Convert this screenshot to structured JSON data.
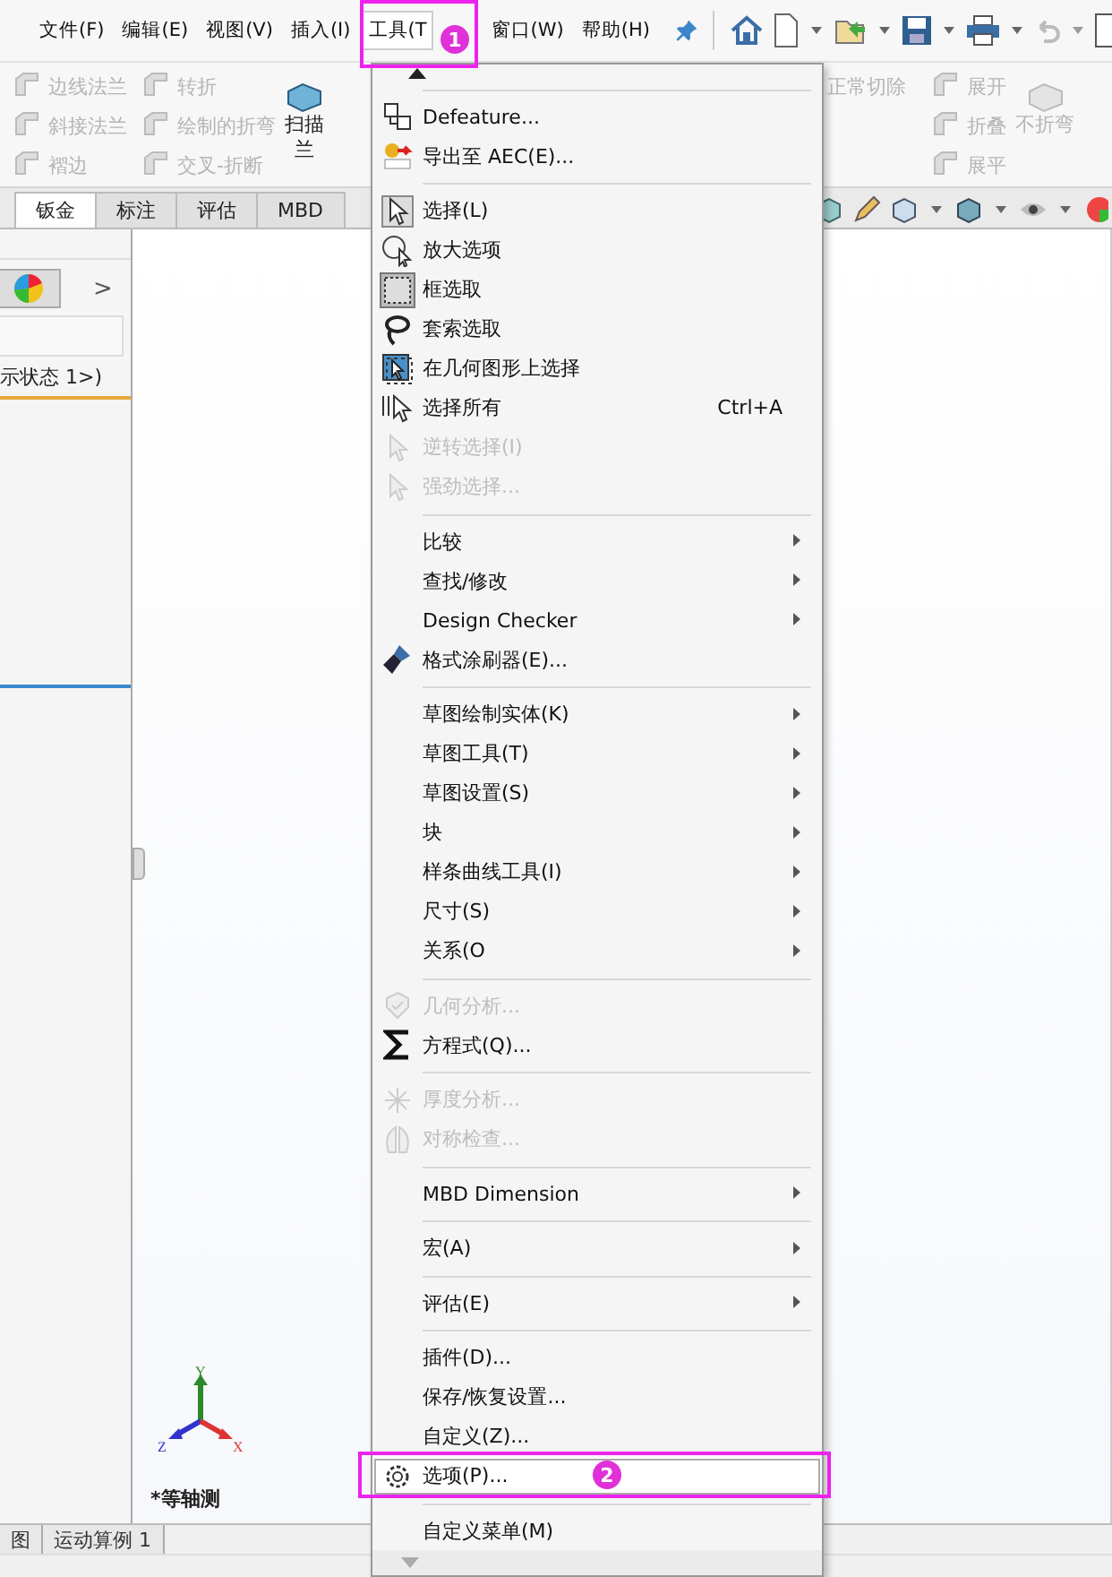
{
  "menubar": {
    "items": [
      {
        "label": "文件(F)",
        "selected": false
      },
      {
        "label": "编辑(E)",
        "selected": false
      },
      {
        "label": "视图(V)",
        "selected": false
      },
      {
        "label": "插入(I)",
        "selected": false
      },
      {
        "label": "工具(T",
        "selected": true
      },
      {
        "label": "窗口(W)",
        "selected": false
      },
      {
        "label": "帮助(H)",
        "selected": false
      }
    ]
  },
  "ribbon": {
    "columns": [
      {
        "kind": "small",
        "items": [
          {
            "label": "边线法兰",
            "disabled": true
          },
          {
            "label": "斜接法兰",
            "disabled": true
          },
          {
            "label": "褶边",
            "disabled": true
          }
        ]
      },
      {
        "kind": "small",
        "items": [
          {
            "label": "转折",
            "disabled": true
          },
          {
            "label": "绘制的折弯",
            "disabled": true
          },
          {
            "label": "交叉-折断",
            "disabled": true
          }
        ]
      },
      {
        "kind": "large",
        "lines": [
          "扫描",
          "兰"
        ],
        "disabled": false
      },
      {
        "kind": "label",
        "items": [
          {
            "label": "正常切除",
            "disabled": true
          }
        ]
      },
      {
        "kind": "small",
        "items": [
          {
            "label": "展开",
            "disabled": true
          },
          {
            "label": "折叠",
            "disabled": true
          },
          {
            "label": "展平",
            "disabled": true
          }
        ]
      },
      {
        "kind": "large",
        "lines": [
          "不折弯"
        ],
        "disabled": true
      }
    ]
  },
  "tabs": [
    {
      "label": "钣金",
      "selected": true
    },
    {
      "label": "标注",
      "selected": false
    },
    {
      "label": "评估",
      "selected": false
    },
    {
      "label": "MBD",
      "selected": false
    }
  ],
  "left_panel": {
    "chevron": ">",
    "config_text": "示状态 1>)"
  },
  "viewport": {
    "view_name": "*等轴测",
    "triad": {
      "x": "X",
      "y": "Y",
      "z": "Z"
    }
  },
  "bottom_tabs": [
    {
      "label": "图",
      "selected": false
    },
    {
      "label": "运动算例 1",
      "selected": false
    }
  ],
  "menu": {
    "items": [
      {
        "kind": "item",
        "label": "Defeature...",
        "disabled": false,
        "submenu": false,
        "selected": false
      },
      {
        "kind": "item",
        "label": "导出至 AEC(E)...",
        "disabled": false,
        "submenu": false,
        "selected": false
      },
      {
        "kind": "separator"
      },
      {
        "kind": "item",
        "label": "选择(L)",
        "disabled": false,
        "submenu": false,
        "selected": false
      },
      {
        "kind": "item",
        "label": "放大选项",
        "disabled": false,
        "submenu": false,
        "selected": false
      },
      {
        "kind": "item",
        "label": "框选取",
        "disabled": false,
        "submenu": false,
        "selected": false
      },
      {
        "kind": "item",
        "label": "套索选取",
        "disabled": false,
        "submenu": false,
        "selected": false
      },
      {
        "kind": "item",
        "label": "在几何图形上选择",
        "disabled": false,
        "submenu": false,
        "selected": false
      },
      {
        "kind": "item",
        "label": "选择所有",
        "shortcut": "Ctrl+A",
        "disabled": false,
        "submenu": false,
        "selected": false
      },
      {
        "kind": "item",
        "label": "逆转选择(I)",
        "disabled": true,
        "submenu": false,
        "selected": false
      },
      {
        "kind": "item",
        "label": "强劲选择...",
        "disabled": true,
        "submenu": false,
        "selected": false
      },
      {
        "kind": "separator"
      },
      {
        "kind": "item",
        "label": "比较",
        "disabled": false,
        "submenu": true,
        "selected": false
      },
      {
        "kind": "item",
        "label": "查找/修改",
        "disabled": false,
        "submenu": true,
        "selected": false
      },
      {
        "kind": "item",
        "label": "Design Checker",
        "disabled": false,
        "submenu": true,
        "selected": false
      },
      {
        "kind": "item",
        "label": "格式涂刷器(E)...",
        "disabled": false,
        "submenu": false,
        "selected": false
      },
      {
        "kind": "separator"
      },
      {
        "kind": "item",
        "label": "草图绘制实体(K)",
        "disabled": false,
        "submenu": true,
        "selected": false
      },
      {
        "kind": "item",
        "label": "草图工具(T)",
        "disabled": false,
        "submenu": true,
        "selected": false
      },
      {
        "kind": "item",
        "label": "草图设置(S)",
        "disabled": false,
        "submenu": true,
        "selected": false
      },
      {
        "kind": "item",
        "label": "块",
        "disabled": false,
        "submenu": true,
        "selected": false
      },
      {
        "kind": "item",
        "label": "样条曲线工具(I)",
        "disabled": false,
        "submenu": true,
        "selected": false
      },
      {
        "kind": "item",
        "label": "尺寸(S)",
        "disabled": false,
        "submenu": true,
        "selected": false
      },
      {
        "kind": "item",
        "label": "关系(O",
        "disabled": false,
        "submenu": true,
        "selected": false
      },
      {
        "kind": "separator"
      },
      {
        "kind": "item",
        "label": "几何分析...",
        "disabled": true,
        "submenu": false,
        "selected": false
      },
      {
        "kind": "item",
        "label": "方程式(Q)...",
        "disabled": false,
        "submenu": false,
        "selected": false
      },
      {
        "kind": "separator"
      },
      {
        "kind": "item",
        "label": "厚度分析...",
        "disabled": true,
        "submenu": false,
        "selected": false
      },
      {
        "kind": "item",
        "label": "对称检查...",
        "disabled": true,
        "submenu": false,
        "selected": false
      },
      {
        "kind": "separator"
      },
      {
        "kind": "item",
        "label": "MBD Dimension",
        "disabled": false,
        "submenu": true,
        "selected": false
      },
      {
        "kind": "separator"
      },
      {
        "kind": "item",
        "label": "宏(A)",
        "disabled": false,
        "submenu": true,
        "selected": false
      },
      {
        "kind": "separator"
      },
      {
        "kind": "item",
        "label": "评估(E)",
        "disabled": false,
        "submenu": true,
        "selected": false
      },
      {
        "kind": "separator"
      },
      {
        "kind": "item",
        "label": "插件(D)...",
        "disabled": false,
        "submenu": false,
        "selected": false
      },
      {
        "kind": "item",
        "label": "保存/恢复设置...",
        "disabled": false,
        "submenu": false,
        "selected": false
      },
      {
        "kind": "item",
        "label": "自定义(Z)...",
        "disabled": false,
        "submenu": false,
        "selected": false
      },
      {
        "kind": "item",
        "label": "选项(P)...",
        "disabled": false,
        "submenu": false,
        "selected": true
      },
      {
        "kind": "separator"
      },
      {
        "kind": "item",
        "label": "自定义菜单(M)",
        "disabled": false,
        "submenu": false,
        "selected": false
      }
    ]
  },
  "annotations": [
    {
      "label": "1"
    },
    {
      "label": "2"
    }
  ]
}
